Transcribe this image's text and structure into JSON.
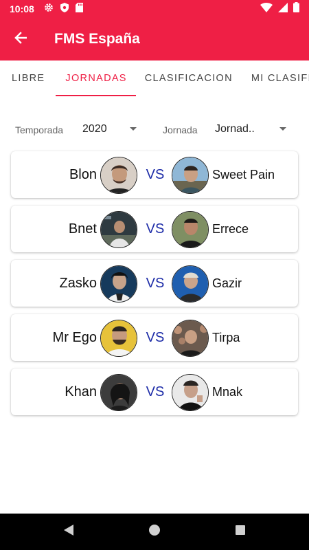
{
  "status_bar": {
    "time": "10:08"
  },
  "app_bar": {
    "title": "FMS España"
  },
  "tabs": [
    {
      "label": "LIBRE",
      "active": false
    },
    {
      "label": "JORNADAS",
      "active": true
    },
    {
      "label": "CLASIFICACION",
      "active": false
    },
    {
      "label": "MI CLASIFI",
      "active": false
    }
  ],
  "filters": {
    "temporada_label": "Temporada",
    "temporada_value": "2020",
    "jornada_label": "Jornada",
    "jornada_value": "Jornad.."
  },
  "vs_label": "VS",
  "matches": [
    {
      "left": "Blon",
      "right": "Sweet Pain"
    },
    {
      "left": "Bnet",
      "right": "Errece"
    },
    {
      "left": "Zasko",
      "right": "Gazir"
    },
    {
      "left": "Mr Ego",
      "right": "Tirpa"
    },
    {
      "left": "Khan",
      "right": "Mnak"
    }
  ],
  "colors": {
    "primary": "#ef1f45",
    "vs": "#1e2da8",
    "nav": "#000000"
  },
  "icons": {
    "back": "arrow-left-icon",
    "dropdown": "dropdown-arrow-icon",
    "nav": [
      "back-triangle-icon",
      "home-circle-icon",
      "recents-square-icon"
    ]
  }
}
